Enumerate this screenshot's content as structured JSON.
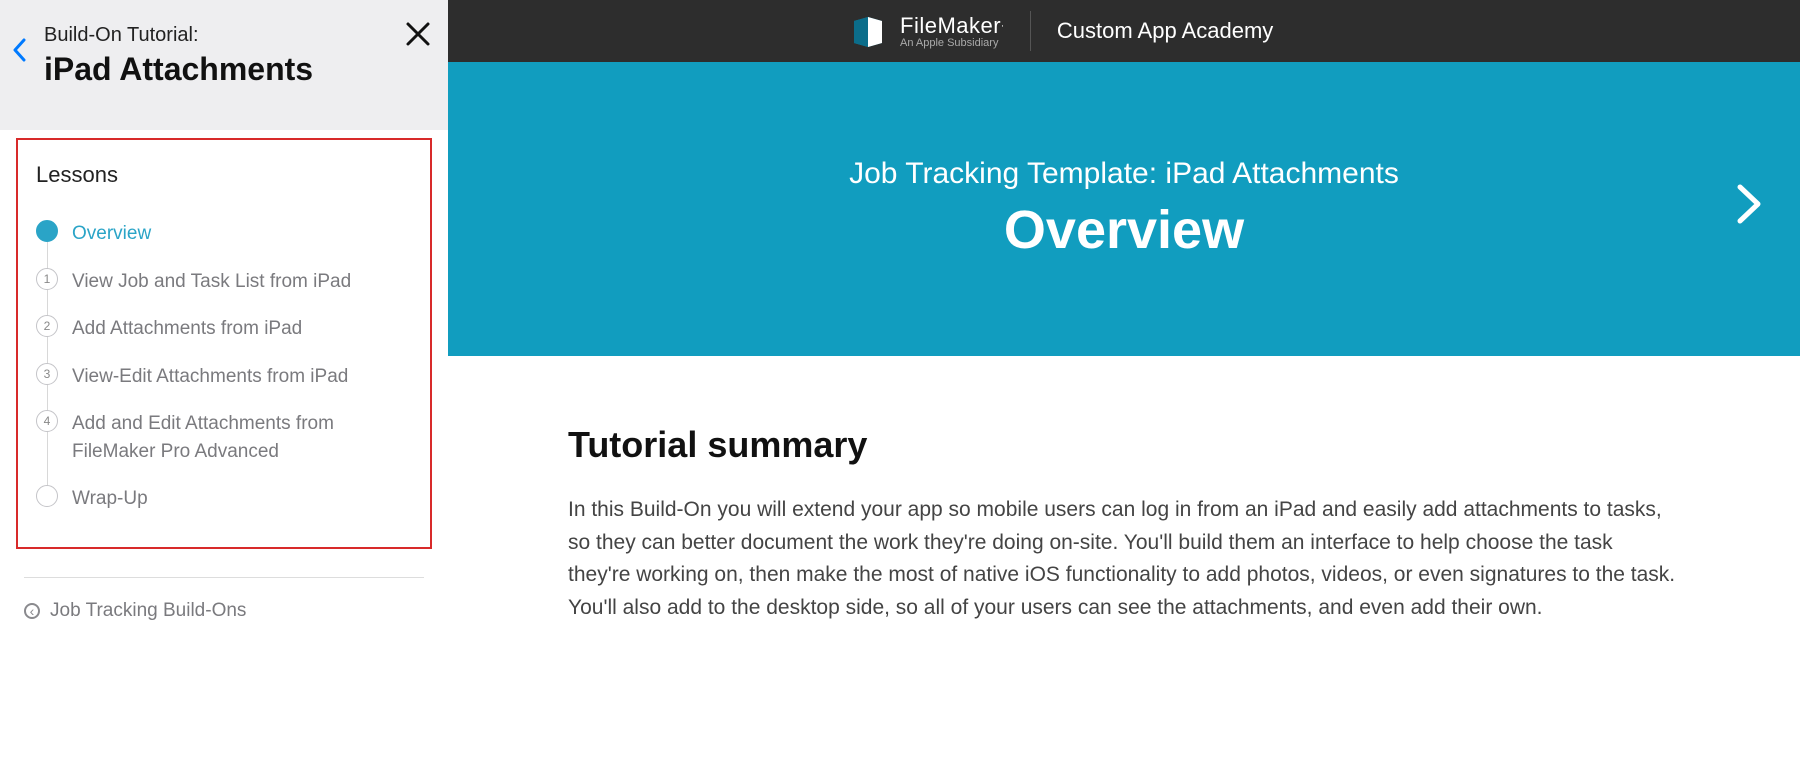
{
  "sidebar": {
    "pretitle": "Build-On Tutorial:",
    "title": "iPad Attachments",
    "lessons_heading": "Lessons",
    "lessons": [
      {
        "marker": "",
        "label": "Overview",
        "active": true,
        "type": "dot"
      },
      {
        "marker": "1",
        "label": "View Job and Task List from iPad",
        "active": false,
        "type": "num"
      },
      {
        "marker": "2",
        "label": "Add Attachments from iPad",
        "active": false,
        "type": "num"
      },
      {
        "marker": "3",
        "label": "View-Edit Attachments from iPad",
        "active": false,
        "type": "num"
      },
      {
        "marker": "4",
        "label": "Add and Edit Attachments from FileMaker Pro Advanced",
        "active": false,
        "type": "num"
      },
      {
        "marker": "",
        "label": "Wrap-Up",
        "active": false,
        "type": "hollow"
      }
    ],
    "footer_link": "Job Tracking Build-Ons"
  },
  "topbar": {
    "brand_name": "FileMaker",
    "brand_sub": "An Apple Subsidiary",
    "academy": "Custom App Academy"
  },
  "hero": {
    "subtitle": "Job Tracking Template: iPad Attachments",
    "title": "Overview"
  },
  "content": {
    "heading": "Tutorial summary",
    "body": "In this Build-On you will extend your app so mobile users can log in from an iPad and easily add attachments to tasks, so they can better document the work they're doing on-site. You'll build them an interface to help choose the task they're working on, then make the most of native iOS functionality to add photos, videos, or even signatures to the task. You'll also add to the desktop side, so all of your users can see the attachments, and even add their own."
  }
}
